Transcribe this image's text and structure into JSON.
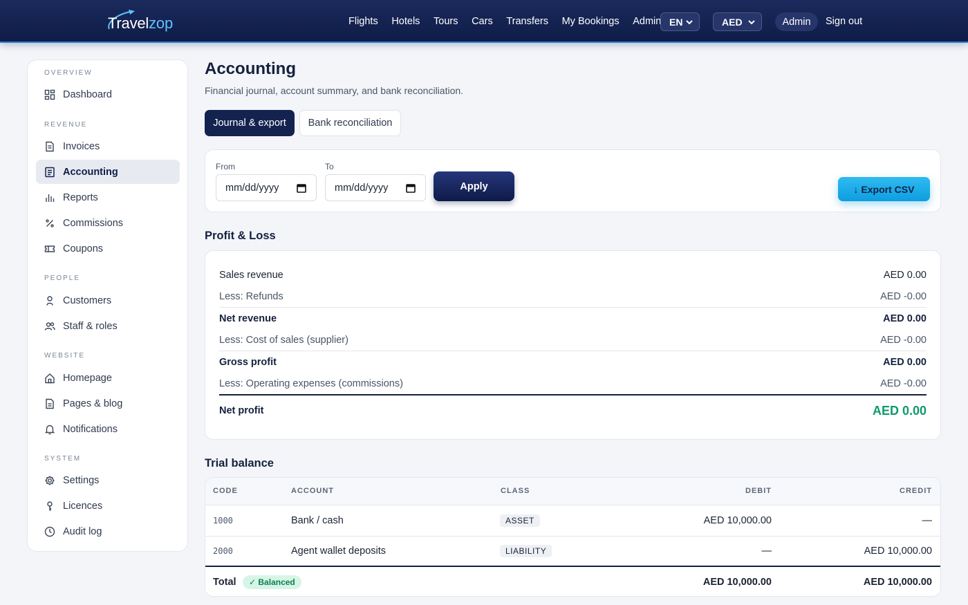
{
  "brand": {
    "name_main": "Travel",
    "name_accent": "zop"
  },
  "nav": {
    "items": [
      "Flights",
      "Hotels",
      "Tours",
      "Cars",
      "Transfers",
      "My Bookings",
      "Admin"
    ]
  },
  "lang_select": {
    "value": "EN"
  },
  "currency_select": {
    "value": "AED"
  },
  "user": {
    "label": "Admin",
    "signout": "Sign out"
  },
  "sidebar": {
    "sections": [
      {
        "title": "OVERVIEW",
        "items": [
          {
            "label": "Dashboard",
            "icon": "dashboard-icon"
          }
        ]
      },
      {
        "title": "REVENUE",
        "items": [
          {
            "label": "Invoices",
            "icon": "invoice-icon"
          },
          {
            "label": "Accounting",
            "icon": "accounting-icon",
            "active": true
          },
          {
            "label": "Reports",
            "icon": "bar-chart-icon"
          },
          {
            "label": "Commissions",
            "icon": "percent-icon"
          },
          {
            "label": "Coupons",
            "icon": "ticket-icon"
          }
        ]
      },
      {
        "title": "PEOPLE",
        "items": [
          {
            "label": "Customers",
            "icon": "user-icon"
          },
          {
            "label": "Staff & roles",
            "icon": "users-icon"
          }
        ]
      },
      {
        "title": "WEBSITE",
        "items": [
          {
            "label": "Homepage",
            "icon": "home-icon"
          },
          {
            "label": "Pages & blog",
            "icon": "document-icon"
          },
          {
            "label": "Notifications",
            "icon": "bell-icon"
          }
        ]
      },
      {
        "title": "SYSTEM",
        "items": [
          {
            "label": "Settings",
            "icon": "gear-icon"
          },
          {
            "label": "Licences",
            "icon": "key-icon"
          },
          {
            "label": "Audit log",
            "icon": "clock-icon"
          }
        ]
      }
    ]
  },
  "page": {
    "title": "Accounting",
    "subtitle": "Financial journal, account summary, and bank reconciliation.",
    "tabs": [
      {
        "label": "Journal & export",
        "active": true
      },
      {
        "label": "Bank reconciliation",
        "active": false
      }
    ]
  },
  "filters": {
    "from_label": "From",
    "from_value": "mm/dd/yyyy",
    "to_label": "To",
    "to_value": "mm/dd/yyyy",
    "apply_label": "Apply",
    "export_label": "↓ Export CSV"
  },
  "pnl": {
    "title": "Profit & Loss",
    "rows": [
      {
        "label": "Sales revenue",
        "value": "AED 0.00"
      },
      {
        "label": "Less: Refunds",
        "value": "AED -0.00"
      },
      {
        "label": "Net revenue",
        "value": "AED 0.00"
      },
      {
        "label": "Less: Cost of sales (supplier)",
        "value": "AED -0.00"
      },
      {
        "label": "Gross profit",
        "value": "AED 0.00"
      },
      {
        "label": "Less: Operating expenses (commissions)",
        "value": "AED -0.00"
      }
    ],
    "net_profit_label": "Net profit",
    "net_profit_value": "AED 0.00",
    "net_profit_color": "#0f9a6a"
  },
  "trial_balance": {
    "title": "Trial balance",
    "columns": [
      "CODE",
      "ACCOUNT",
      "CLASS",
      "DEBIT",
      "CREDIT"
    ],
    "rows": [
      {
        "code": "1000",
        "account": "Bank / cash",
        "class": "ASSET",
        "debit": "AED 10,000.00",
        "credit": "—"
      },
      {
        "code": "2000",
        "account": "Agent wallet deposits",
        "class": "LIABILITY",
        "debit": "—",
        "credit": "AED 10,000.00"
      }
    ],
    "total_label": "Total",
    "balanced_label": "✓ Balanced",
    "total_debit": "AED 10,000.00",
    "total_credit": "AED 10,000.00"
  },
  "colors": {
    "header": "#0f1c48",
    "accent": "#0e9ee0",
    "positive": "#0f9a6a"
  }
}
